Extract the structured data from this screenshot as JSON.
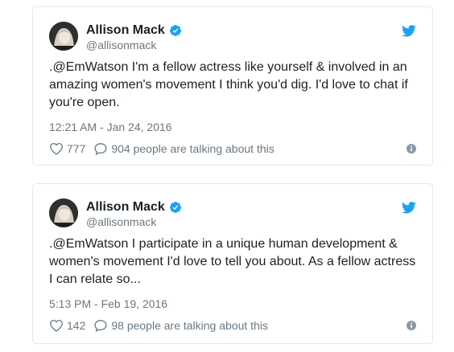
{
  "colors": {
    "twitter_blue": "#1da1f2",
    "text_primary": "#1c2022",
    "text_secondary": "#697882",
    "border": "#e1e8ed"
  },
  "tweets": [
    {
      "display_name": "Allison Mack",
      "handle": "@allisonmack",
      "text": ".@EmWatson I'm a fellow actress like yourself & involved in an amazing women's movement I think you'd dig. I'd love to chat if you're open.",
      "timestamp": "12:21 AM - Jan 24, 2016",
      "likes": "777",
      "talking": "904 people are talking about this",
      "icons": {
        "verified": "verified-badge-icon",
        "brand": "twitter-bird-icon",
        "like": "heart-icon",
        "reply": "reply-bubble-icon",
        "info": "info-icon"
      }
    },
    {
      "display_name": "Allison Mack",
      "handle": "@allisonmack",
      "text": ".@EmWatson I participate in a unique human development & women's movement I'd love to tell you about. As a fellow actress I can relate so...",
      "timestamp": "5:13 PM - Feb 19, 2016",
      "likes": "142",
      "talking": "98 people are talking about this",
      "icons": {
        "verified": "verified-badge-icon",
        "brand": "twitter-bird-icon",
        "like": "heart-icon",
        "reply": "reply-bubble-icon",
        "info": "info-icon"
      }
    }
  ]
}
